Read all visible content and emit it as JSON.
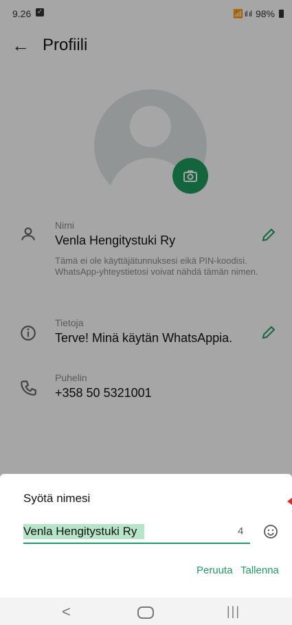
{
  "status": {
    "time": "9.26",
    "check_icon": "checkbox-icon",
    "battery": "98%",
    "signal_text": "📶 ıl ıl"
  },
  "appbar": {
    "title": "Profiili",
    "back_icon": "arrow-back-icon"
  },
  "profile": {
    "avatar_icon": "person-avatar-icon",
    "camera_icon": "camera-icon",
    "name": {
      "label": "Nimi",
      "value": "Venla Hengitystuki Ry",
      "note": "Tämä ei ole käyttäjätunnuksesi eikä PIN-koodisi. WhatsApp-yhteystietosi voivat nähdä tämän nimen.",
      "icon": "person-icon",
      "edit_icon": "pencil-icon"
    },
    "about": {
      "label": "Tietoja",
      "value": "Terve! Minä käytän WhatsAppia.",
      "icon": "info-icon",
      "edit_icon": "pencil-icon"
    },
    "phone": {
      "label": "Puhelin",
      "value": "+358 50 5321001",
      "icon": "phone-icon"
    }
  },
  "sheet": {
    "title": "Syötä nimesi",
    "input_value": "Venla Hengitystuki Ry",
    "char_count": "4",
    "emoji_icon": "emoji-icon",
    "cancel_label": "Peruuta",
    "save_label": "Tallenna"
  },
  "navbar": {
    "back": "<",
    "recent": "|||"
  },
  "colors": {
    "accent": "#1e9b5f",
    "selection": "#b7e5c9",
    "overlay": "rgba(0,0,0,0.35)"
  }
}
